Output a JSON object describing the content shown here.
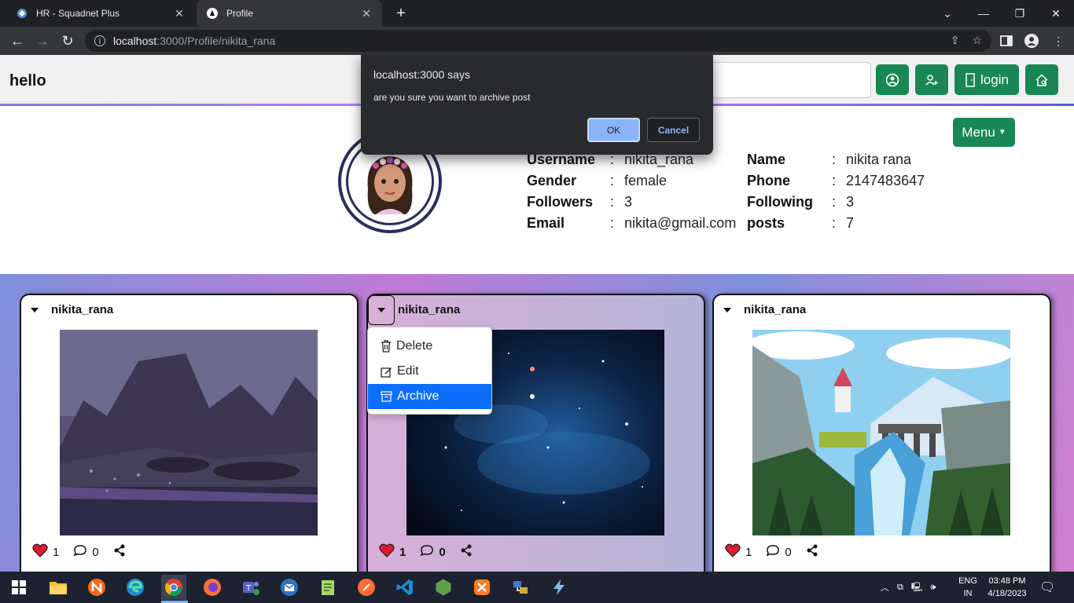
{
  "browser": {
    "tabs": [
      {
        "title": "HR - Squadnet Plus",
        "active": false
      },
      {
        "title": "Profile",
        "active": true
      }
    ],
    "url_host": "localhost",
    "url_path": ":3000/Profile/nikita_rana"
  },
  "header": {
    "brand": "hello",
    "login_label": "login"
  },
  "profile": {
    "menu_label": "Menu",
    "fields": [
      {
        "key": "Username",
        "value": "nikita_rana"
      },
      {
        "key": "Gender",
        "value": "female"
      },
      {
        "key": "Followers",
        "value": "3"
      },
      {
        "key": "Email",
        "value": "nikita@gmail.com"
      },
      {
        "key": "Name",
        "value": "nikita rana"
      },
      {
        "key": "Phone",
        "value": "2147483647"
      },
      {
        "key": "Following",
        "value": "3"
      },
      {
        "key": "posts",
        "value": "7"
      }
    ],
    "colon": ":"
  },
  "posts": [
    {
      "username": "nikita_rana",
      "likes": "1",
      "comments": "0",
      "image": "purple-coastal-landscape"
    },
    {
      "username": "nikita_rana",
      "likes": "1",
      "comments": "0",
      "image": "starry-galaxy"
    },
    {
      "username": "nikita_rana",
      "likes": "1",
      "comments": "0",
      "image": "pixel-art-waterfall-castle"
    }
  ],
  "post_menu": {
    "items": [
      {
        "label": "Delete",
        "icon": "trash-icon"
      },
      {
        "label": "Edit",
        "icon": "edit-icon"
      },
      {
        "label": "Archive",
        "icon": "archive-icon",
        "highlighted": true
      }
    ]
  },
  "dialog": {
    "title": "localhost:3000 says",
    "message": "are you sure you want to archive post",
    "ok_label": "OK",
    "cancel_label": "Cancel"
  },
  "taskbar": {
    "lang_top": "ENG",
    "lang_bottom": "IN",
    "time": "03:48 PM",
    "date": "4/18/2023"
  },
  "colors": {
    "accent_green": "#198754",
    "dropdown_active": "#0d6efd",
    "dialog_bg": "#292a2d",
    "ok_button": "#8ab4f8"
  }
}
